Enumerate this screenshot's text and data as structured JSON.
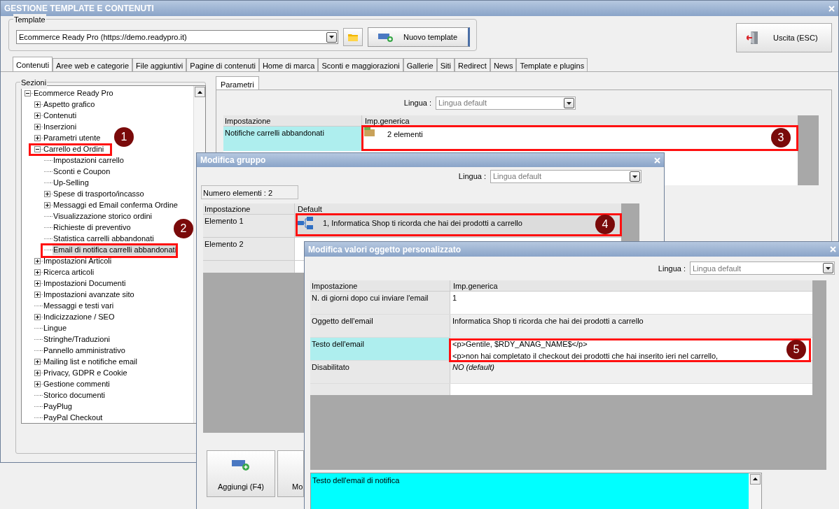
{
  "window": {
    "title": "GESTIONE TEMPLATE E CONTENUTI"
  },
  "template": {
    "label": "Template",
    "value": "Ecommerce Ready Pro (https://demo.readypro.it)",
    "new_button": "Nuovo template"
  },
  "exit_button": "Uscita (ESC)",
  "tabs": [
    {
      "label": "Contenuti",
      "selected": true
    },
    {
      "label": "Aree web e categorie",
      "selected": false
    },
    {
      "label": "File aggiuntivi",
      "selected": false
    },
    {
      "label": "Pagine di contenuti",
      "selected": false
    },
    {
      "label": "Home di marca",
      "selected": false
    },
    {
      "label": "Sconti e maggiorazioni",
      "selected": false
    },
    {
      "label": "Gallerie",
      "selected": false
    },
    {
      "label": "Siti",
      "selected": false
    },
    {
      "label": "Redirect",
      "selected": false
    },
    {
      "label": "News",
      "selected": false
    },
    {
      "label": "Template e plugins",
      "selected": false
    }
  ],
  "sections": {
    "label": "Sezioni",
    "tree": [
      {
        "label": "Ecommerce Ready Pro",
        "kind": "folder",
        "expanded": true,
        "selected": false,
        "children": [
          {
            "label": "Aspetto grafico",
            "kind": "folder",
            "expanded": false,
            "selected": false
          },
          {
            "label": "Contenuti",
            "kind": "folder",
            "expanded": false,
            "selected": false
          },
          {
            "label": "Inserzioni",
            "kind": "folder",
            "expanded": false,
            "selected": false
          },
          {
            "label": "Parametri utente",
            "kind": "folder",
            "expanded": false,
            "selected": false
          },
          {
            "label": "Carrello ed Ordini",
            "kind": "folder",
            "expanded": true,
            "selected": false,
            "children": [
              {
                "label": "Impostazioni carrello",
                "kind": "leaf",
                "selected": false
              },
              {
                "label": "Sconti e Coupon",
                "kind": "leaf",
                "selected": false
              },
              {
                "label": "Up-Selling",
                "kind": "leaf",
                "selected": false
              },
              {
                "label": "Spese di trasporto/incasso",
                "kind": "folder",
                "expanded": false,
                "selected": false
              },
              {
                "label": "Messaggi ed Email conferma Ordine",
                "kind": "folder",
                "expanded": false,
                "selected": false
              },
              {
                "label": "Visualizzazione storico ordini",
                "kind": "leaf",
                "selected": false
              },
              {
                "label": "Richieste di preventivo",
                "kind": "leaf",
                "selected": false
              },
              {
                "label": "Statistica carrelli abbandonati",
                "kind": "leaf",
                "selected": false
              },
              {
                "label": "Email di notifica carrelli abbandonati",
                "kind": "leaf",
                "selected": true
              }
            ]
          },
          {
            "label": "Impostazioni Articoli",
            "kind": "folder",
            "expanded": false,
            "selected": false
          },
          {
            "label": "Ricerca articoli",
            "kind": "folder",
            "expanded": false,
            "selected": false
          },
          {
            "label": "Impostazioni Documenti",
            "kind": "folder",
            "expanded": false,
            "selected": false
          },
          {
            "label": "Impostazioni avanzate sito",
            "kind": "folder",
            "expanded": false,
            "selected": false
          },
          {
            "label": "Messaggi e testi vari",
            "kind": "leaf",
            "selected": false
          },
          {
            "label": "Indicizzazione / SEO",
            "kind": "folder",
            "expanded": false,
            "selected": false
          },
          {
            "label": "Lingue",
            "kind": "leaf",
            "selected": false
          },
          {
            "label": "Stringhe/Traduzioni",
            "kind": "leaf",
            "selected": false
          },
          {
            "label": "Pannello amministrativo",
            "kind": "leaf",
            "selected": false
          },
          {
            "label": "Mailing list e notifiche email",
            "kind": "folder",
            "expanded": false,
            "selected": false
          },
          {
            "label": "Privacy, GDPR e Cookie",
            "kind": "folder",
            "expanded": false,
            "selected": false
          },
          {
            "label": "Gestione commenti",
            "kind": "folder",
            "expanded": false,
            "selected": false
          },
          {
            "label": "Storico documenti",
            "kind": "leaf",
            "selected": false
          },
          {
            "label": "PayPlug",
            "kind": "leaf",
            "selected": false
          },
          {
            "label": "PayPal Checkout",
            "kind": "leaf",
            "selected": false
          }
        ]
      }
    ]
  },
  "parameters": {
    "tab": "Parametri",
    "language_label": "Lingua :",
    "language": "Lingua default",
    "columns": [
      "Impostazione",
      "Imp.generica"
    ],
    "rows": [
      {
        "setting": "Notifiche carrelli abbandonati",
        "value": "2 elementi",
        "highlighted": true
      }
    ]
  },
  "group_dialog": {
    "title": "Modifica gruppo",
    "language_label": "Lingua :",
    "language": "Lingua default",
    "count": "Numero elementi : 2",
    "columns": [
      "Impostazione",
      "Default"
    ],
    "rows": [
      {
        "setting": "Elemento 1",
        "value": "1, Informatica Shop ti ricorda che hai dei prodotti a carrello",
        "selected": true
      },
      {
        "setting": "Elemento 2",
        "selected": false
      }
    ],
    "buttons": [
      "Aggiungi (F4)",
      "Mo"
    ]
  },
  "object_dialog": {
    "title": "Modifica valori oggetto personalizzato",
    "language_label": "Lingua :",
    "language": "Lingua default",
    "columns": [
      "Impostazione",
      "Imp.generica"
    ],
    "rows": [
      {
        "setting": "N. di giorni dopo cui inviare l'email",
        "kind": "plain",
        "highlighted": false,
        "lines": [
          "1"
        ]
      },
      {
        "setting": "Oggetto dell'email",
        "kind": "plain",
        "highlighted": false,
        "lines": [
          "Informatica Shop ti ricorda che hai dei prodotti a carrello"
        ]
      },
      {
        "setting": "Testo dell'email",
        "kind": "plain",
        "highlighted": true,
        "lines": [
          "<p>Gentile, $RDY_ANAG_NAME$</p>",
          "<p>non hai completato il checkout dei prodotti che hai inserito ieri nel carrello,"
        ]
      },
      {
        "setting": "Disabilitato",
        "kind": "default",
        "highlighted": false,
        "lines": [
          "NO (default)"
        ]
      }
    ],
    "description": "Testo dell'email di notifica"
  },
  "annotations": [
    {
      "number": "1"
    },
    {
      "number": "2"
    },
    {
      "number": "3"
    },
    {
      "number": "4"
    },
    {
      "number": "5"
    }
  ]
}
